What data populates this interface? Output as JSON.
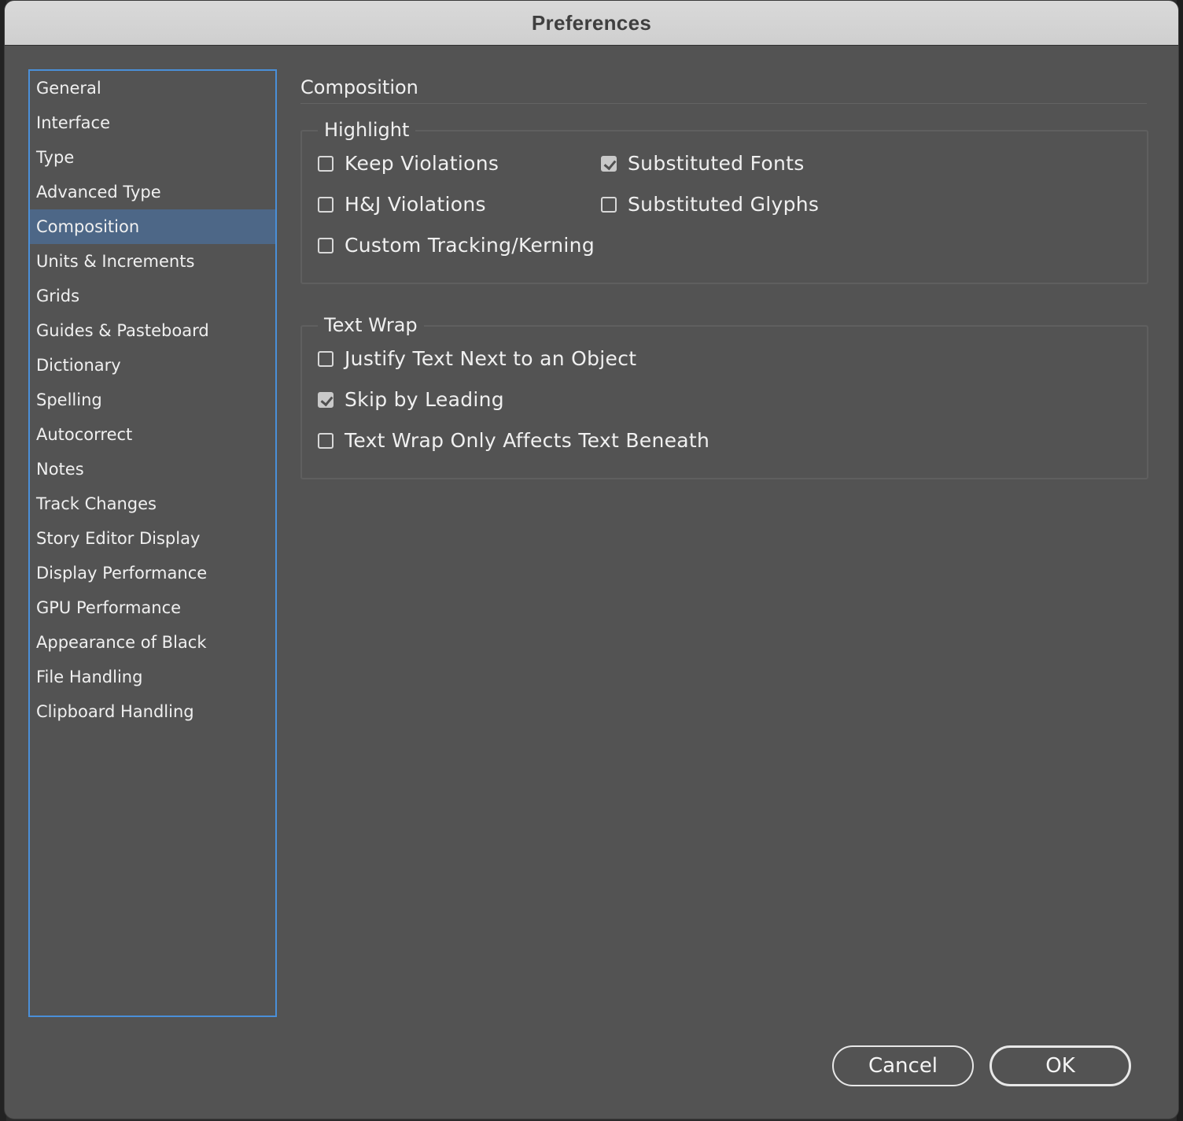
{
  "window": {
    "title": "Preferences"
  },
  "sidebar": {
    "selected_index": 4,
    "items": [
      {
        "label": "General"
      },
      {
        "label": "Interface"
      },
      {
        "label": "Type"
      },
      {
        "label": "Advanced Type"
      },
      {
        "label": "Composition"
      },
      {
        "label": "Units & Increments"
      },
      {
        "label": "Grids"
      },
      {
        "label": "Guides & Pasteboard"
      },
      {
        "label": "Dictionary"
      },
      {
        "label": "Spelling"
      },
      {
        "label": "Autocorrect"
      },
      {
        "label": "Notes"
      },
      {
        "label": "Track Changes"
      },
      {
        "label": "Story Editor Display"
      },
      {
        "label": "Display Performance"
      },
      {
        "label": "GPU Performance"
      },
      {
        "label": "Appearance of Black"
      },
      {
        "label": "File Handling"
      },
      {
        "label": "Clipboard Handling"
      }
    ]
  },
  "content": {
    "heading": "Composition",
    "highlight": {
      "legend": "Highlight",
      "keep_violations": {
        "label": "Keep Violations",
        "checked": false
      },
      "substituted_fonts": {
        "label": "Substituted Fonts",
        "checked": true
      },
      "hj_violations": {
        "label": "H&J Violations",
        "checked": false
      },
      "substituted_glyphs": {
        "label": "Substituted Glyphs",
        "checked": false
      },
      "custom_tracking": {
        "label": "Custom Tracking/Kerning",
        "checked": false
      }
    },
    "text_wrap": {
      "legend": "Text Wrap",
      "justify_text": {
        "label": "Justify Text Next to an Object",
        "checked": false
      },
      "skip_by_leading": {
        "label": "Skip by Leading",
        "checked": true
      },
      "affects_beneath": {
        "label": "Text Wrap Only Affects Text Beneath",
        "checked": false
      }
    }
  },
  "buttons": {
    "cancel": "Cancel",
    "ok": "OK"
  },
  "colors": {
    "panel_bg": "#535353",
    "selection_bg": "#4d6787",
    "focus_ring": "#4a8fd8"
  }
}
